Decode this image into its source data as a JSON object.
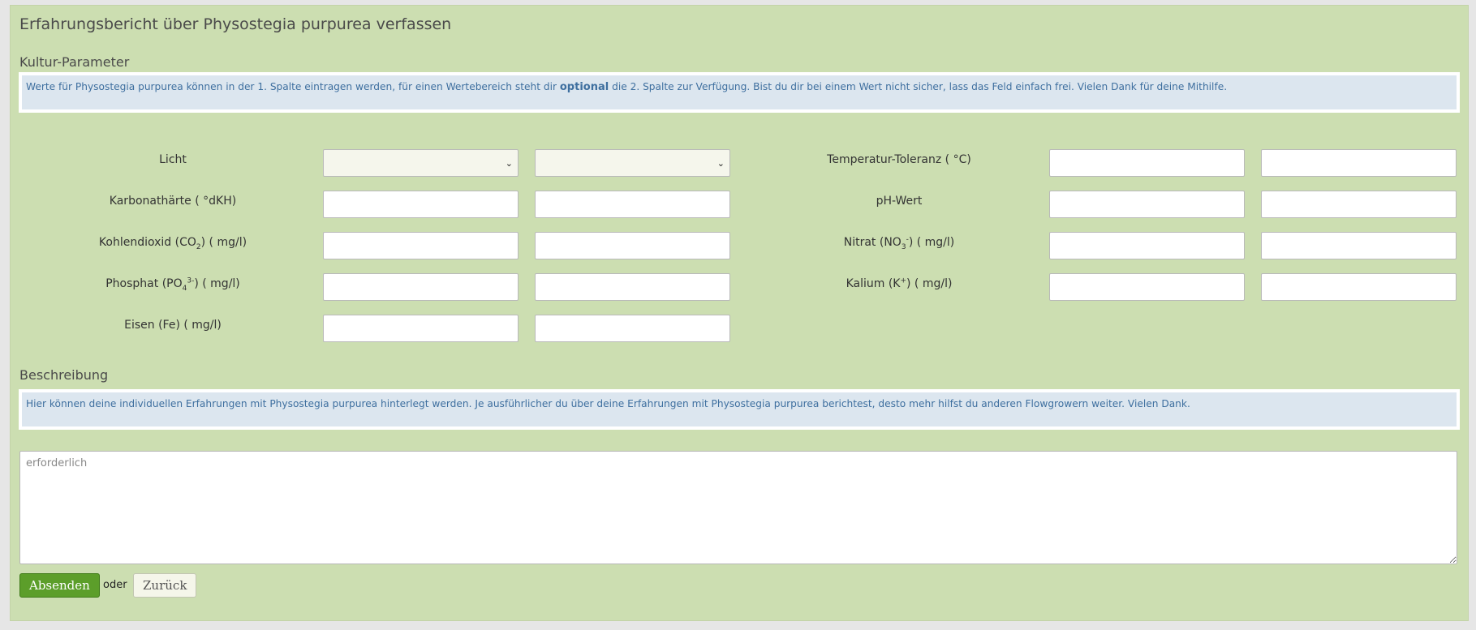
{
  "page": {
    "title": "Erfahrungsbericht über Physostegia purpurea verfassen"
  },
  "kultur": {
    "heading": "Kultur-Parameter",
    "info_before": "Werte für Physostegia purpurea können in der 1. Spalte eintragen werden, für einen Wertebereich steht dir ",
    "info_bold": "optional",
    "info_after": " die 2. Spalte zur Verfügung. Bist du dir bei einem Wert nicht sicher, lass das Feld einfach frei. Vielen Dank für deine Mithilfe.",
    "params": {
      "licht": "Licht",
      "temperatur": "Temperatur-Toleranz ( °C)",
      "karbonat": "Karbonathärte ( °dKH)",
      "ph": "pH-Wert",
      "co2_pre": "Kohlendioxid (CO",
      "co2_sub": "2",
      "co2_post": ") ( mg/l)",
      "nitrat_pre": "Nitrat (NO",
      "nitrat_sub": "3",
      "nitrat_sup": "-",
      "nitrat_post": ") ( mg/l)",
      "phosphat_pre": "Phosphat (PO",
      "phosphat_sub": "4",
      "phosphat_sup": "3-",
      "phosphat_post": ") ( mg/l)",
      "kalium_pre": "Kalium (K",
      "kalium_sup": "+",
      "kalium_post": ") ( mg/l)",
      "eisen": "Eisen (Fe) ( mg/l)"
    }
  },
  "beschreibung": {
    "heading": "Beschreibung",
    "info": "Hier können deine individuellen Erfahrungen mit Physostegia purpurea hinterlegt werden. Je ausführlicher du über deine Erfahrungen mit Physostegia purpurea berichtest, desto mehr hilfst du anderen Flowgrowern weiter. Vielen Dank.",
    "placeholder": "erforderlich"
  },
  "actions": {
    "submit": "Absenden",
    "or": "oder",
    "back": "Zurück"
  },
  "colors": {
    "panel_bg": "#ccdeb1",
    "info_bg": "#dce6ef",
    "info_text": "#3e6f9f",
    "primary": "#5c9e2a"
  },
  "icons": {
    "select_arrow": "chevron-down-icon"
  }
}
